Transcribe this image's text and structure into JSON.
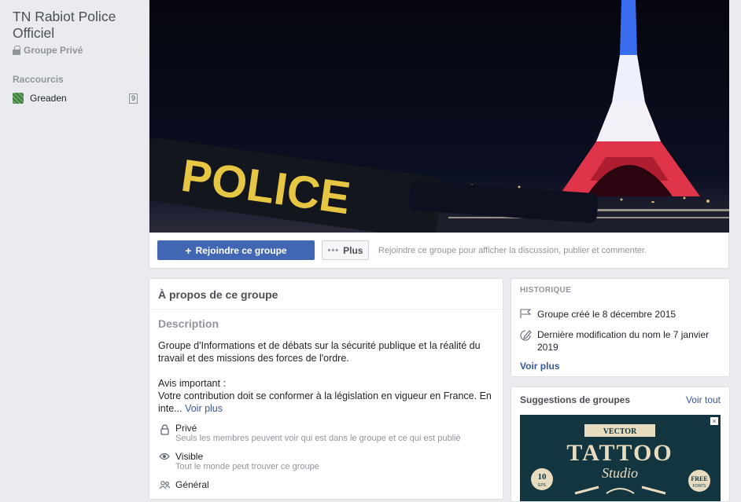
{
  "sidebar": {
    "group_name": "TN Rabiot Police Officiel",
    "privacy_label": "Groupe Privé",
    "shortcuts_heading": "Raccourcis",
    "shortcuts": [
      {
        "label": "Greaden",
        "badge": "9"
      }
    ]
  },
  "cover": {
    "tape_text": "POLICE"
  },
  "action_bar": {
    "join_label": "Rejoindre ce groupe",
    "more_label": "Plus",
    "hint": "Rejoindre ce groupe pour afficher la discussion, publier et commenter."
  },
  "about": {
    "heading": "À propos de ce groupe",
    "description_label": "Description",
    "description_text": "Groupe d'Informations et de débats sur la sécurité publique et la réalité du travail et des missions des forces de l'ordre.\n\nAvis important :\nVotre contribution doit se conformer à la législation en vigueur en France. En inte...",
    "see_more": "Voir plus",
    "properties": [
      {
        "icon": "lock-icon",
        "title": "Privé",
        "subtitle": "Seuls les membres peuvent voir qui est dans le groupe et ce qui est publié"
      },
      {
        "icon": "eye-icon",
        "title": "Visible",
        "subtitle": "Tout le monde peut trouver ce groupe"
      },
      {
        "icon": "people-icon",
        "title": "Général",
        "subtitle": ""
      }
    ]
  },
  "history": {
    "heading": "HISTORIQUE",
    "items": [
      {
        "icon": "flag-icon",
        "text": "Groupe créé le 8 décembre 2015"
      },
      {
        "icon": "edit-icon",
        "text": "Dernière modification du nom le 7 janvier 2019"
      }
    ],
    "see_more": "Voir plus"
  },
  "suggestions": {
    "heading": "Suggestions de groupes",
    "see_all": "Voir tout",
    "close": "×",
    "image_texts": {
      "top": "VECTOR",
      "main": "TATTOO",
      "script": "Studio",
      "left_badge_num": "10",
      "left_badge_sub": "EPS",
      "right_badge": "FREE",
      "right_badge_sub": "FONTS"
    }
  },
  "colors": {
    "brand": "#4267b2",
    "link": "#365899",
    "background": "#e9ebee"
  }
}
